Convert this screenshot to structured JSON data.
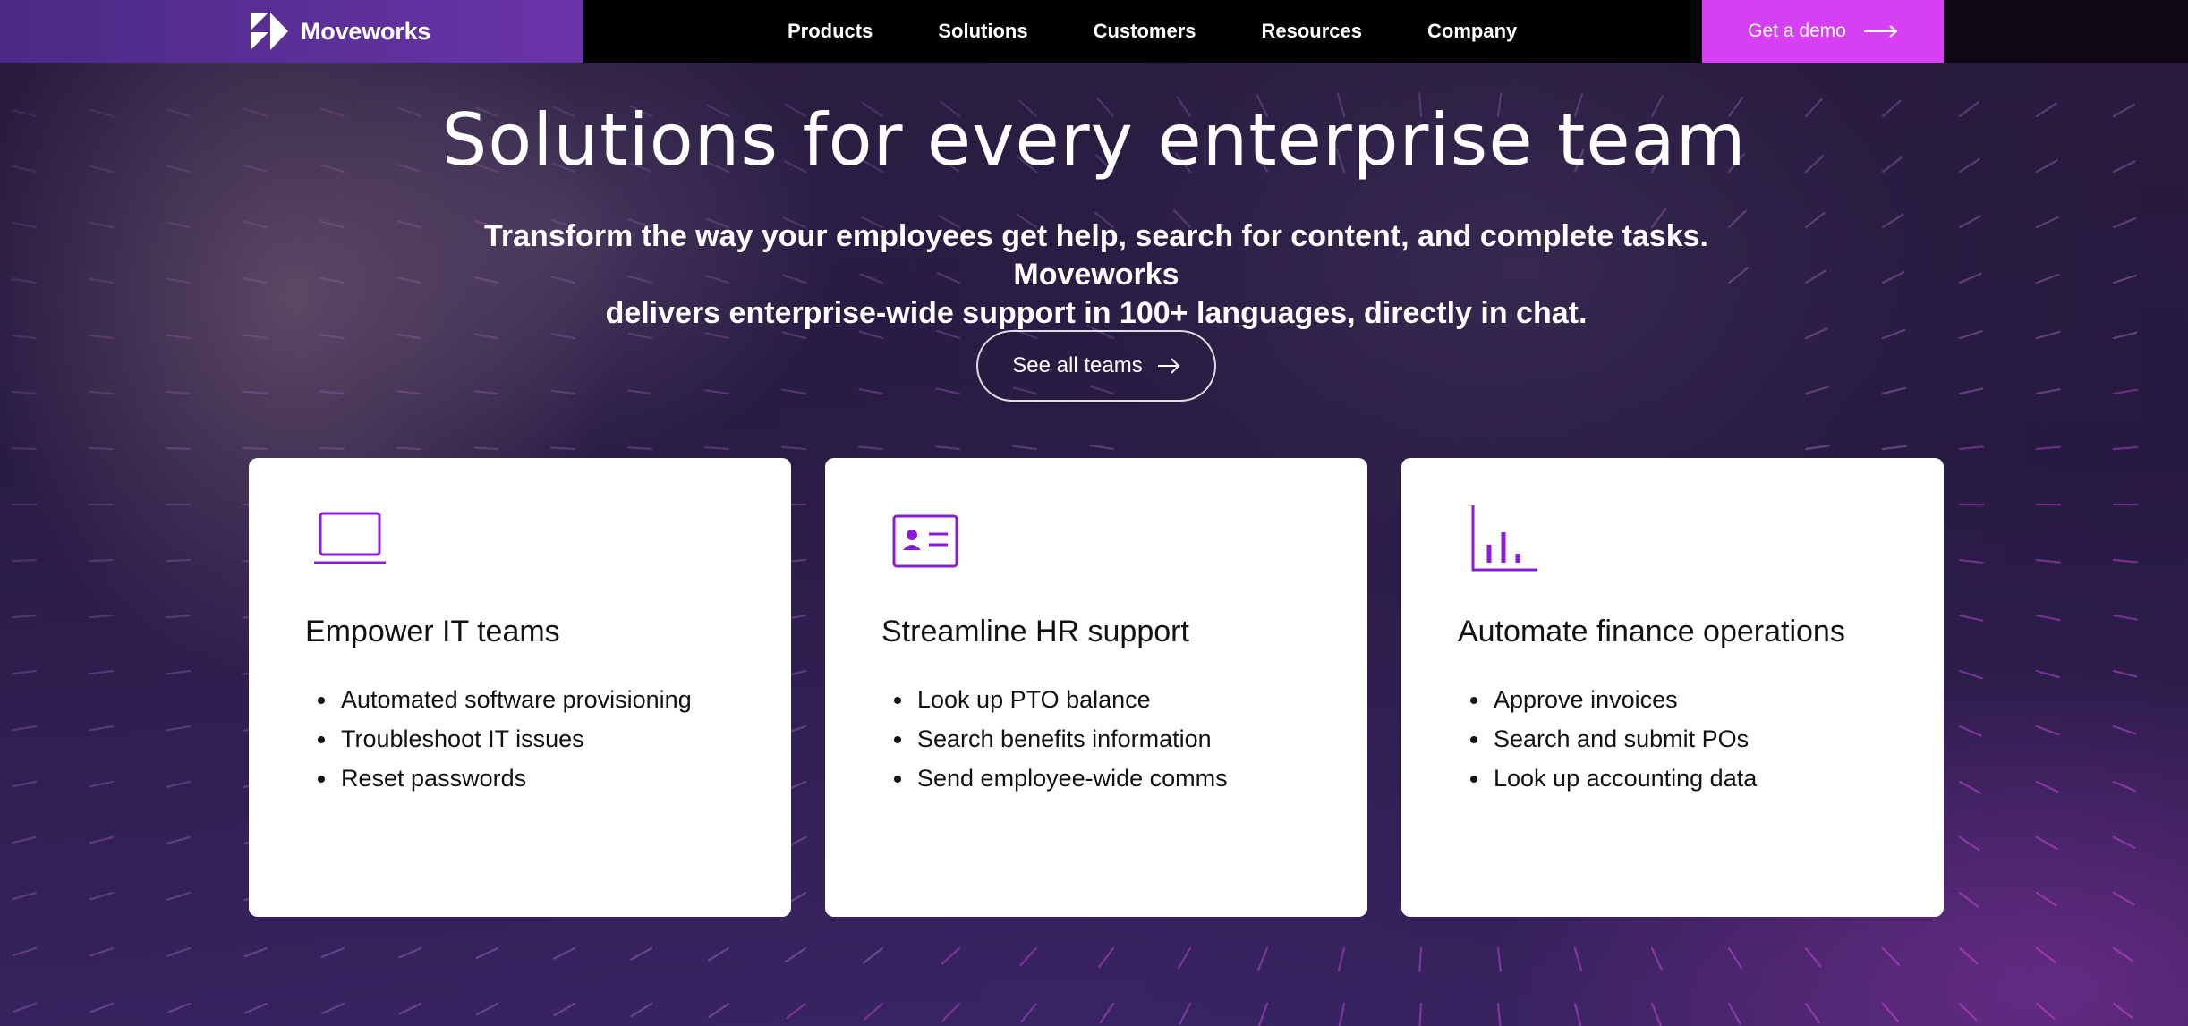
{
  "brand": {
    "name": "Moveworks"
  },
  "nav": {
    "items": [
      "Products",
      "Solutions",
      "Customers",
      "Resources",
      "Company"
    ],
    "cta_label": "Get a demo"
  },
  "hero": {
    "title": "Solutions for every enterprise team",
    "subtitle_line1": "Transform the way your employees get help, search for content, and complete tasks. Moveworks",
    "subtitle_line2": "delivers enterprise-wide support in 100+ languages, directly in chat.",
    "button_label": "See all teams"
  },
  "cards": [
    {
      "icon": "laptop-icon",
      "title": "Empower IT teams",
      "items": [
        "Automated software provisioning",
        "Troubleshoot IT issues",
        "Reset passwords"
      ]
    },
    {
      "icon": "id-card-icon",
      "title": "Streamline HR support",
      "items": [
        "Look up PTO balance",
        "Search benefits information",
        "Send employee-wide comms"
      ]
    },
    {
      "icon": "bar-chart-icon",
      "title": "Automate finance operations",
      "items": [
        "Approve invoices",
        "Search and submit POs",
        "Look up accounting data"
      ]
    }
  ],
  "colors": {
    "accent": "#d63ff2",
    "icon": "#8a1bd9",
    "brand_bar": "#6a34a9"
  }
}
